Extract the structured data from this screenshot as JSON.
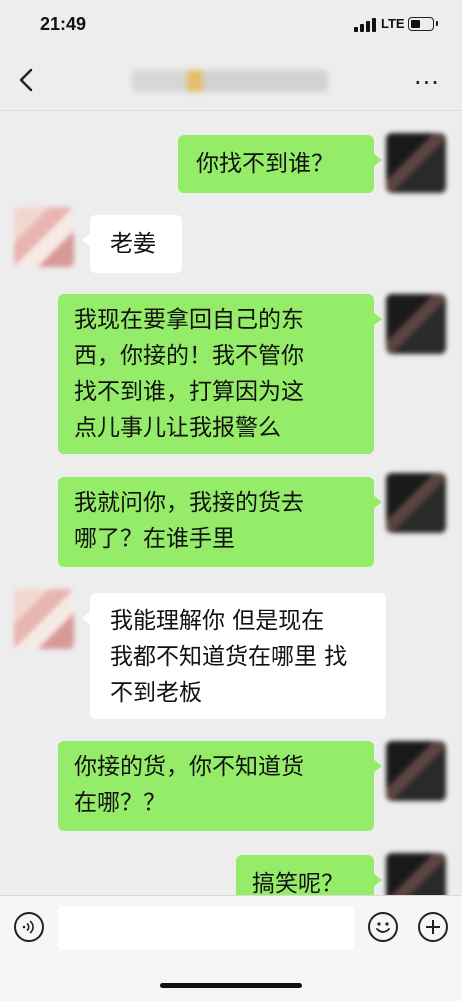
{
  "status": {
    "time": "21:49",
    "network": "LTE"
  },
  "nav": {
    "back_icon": "chevron-left-icon",
    "more_label": "···"
  },
  "messages": [
    {
      "from": "me",
      "text": "你找不到谁？"
    },
    {
      "from": "other",
      "text": "老姜"
    },
    {
      "from": "me",
      "lines": [
        "我现在要拿回自己的东",
        "西，你接的！我不管你",
        "找不到谁，打算因为这",
        "点儿事儿让我报警么"
      ]
    },
    {
      "from": "me",
      "lines": [
        "我就问你，我接的货去",
        "哪了？在谁手里"
      ]
    },
    {
      "from": "other",
      "lines": [
        "我能理解你 但是现在",
        "我都不知道货在哪里 找",
        "不到老板"
      ]
    },
    {
      "from": "me",
      "lines": [
        "你接的货，你不知道货",
        "在哪？？"
      ]
    },
    {
      "from": "me",
      "text": "搞笑呢？"
    }
  ],
  "input": {
    "voice_icon": "voice-icon",
    "emoji_icon": "emoji-icon",
    "plus_icon": "plus-icon"
  },
  "colors": {
    "me_bubble": "#95ec69",
    "other_bubble": "#ffffff",
    "background": "#ededed"
  }
}
